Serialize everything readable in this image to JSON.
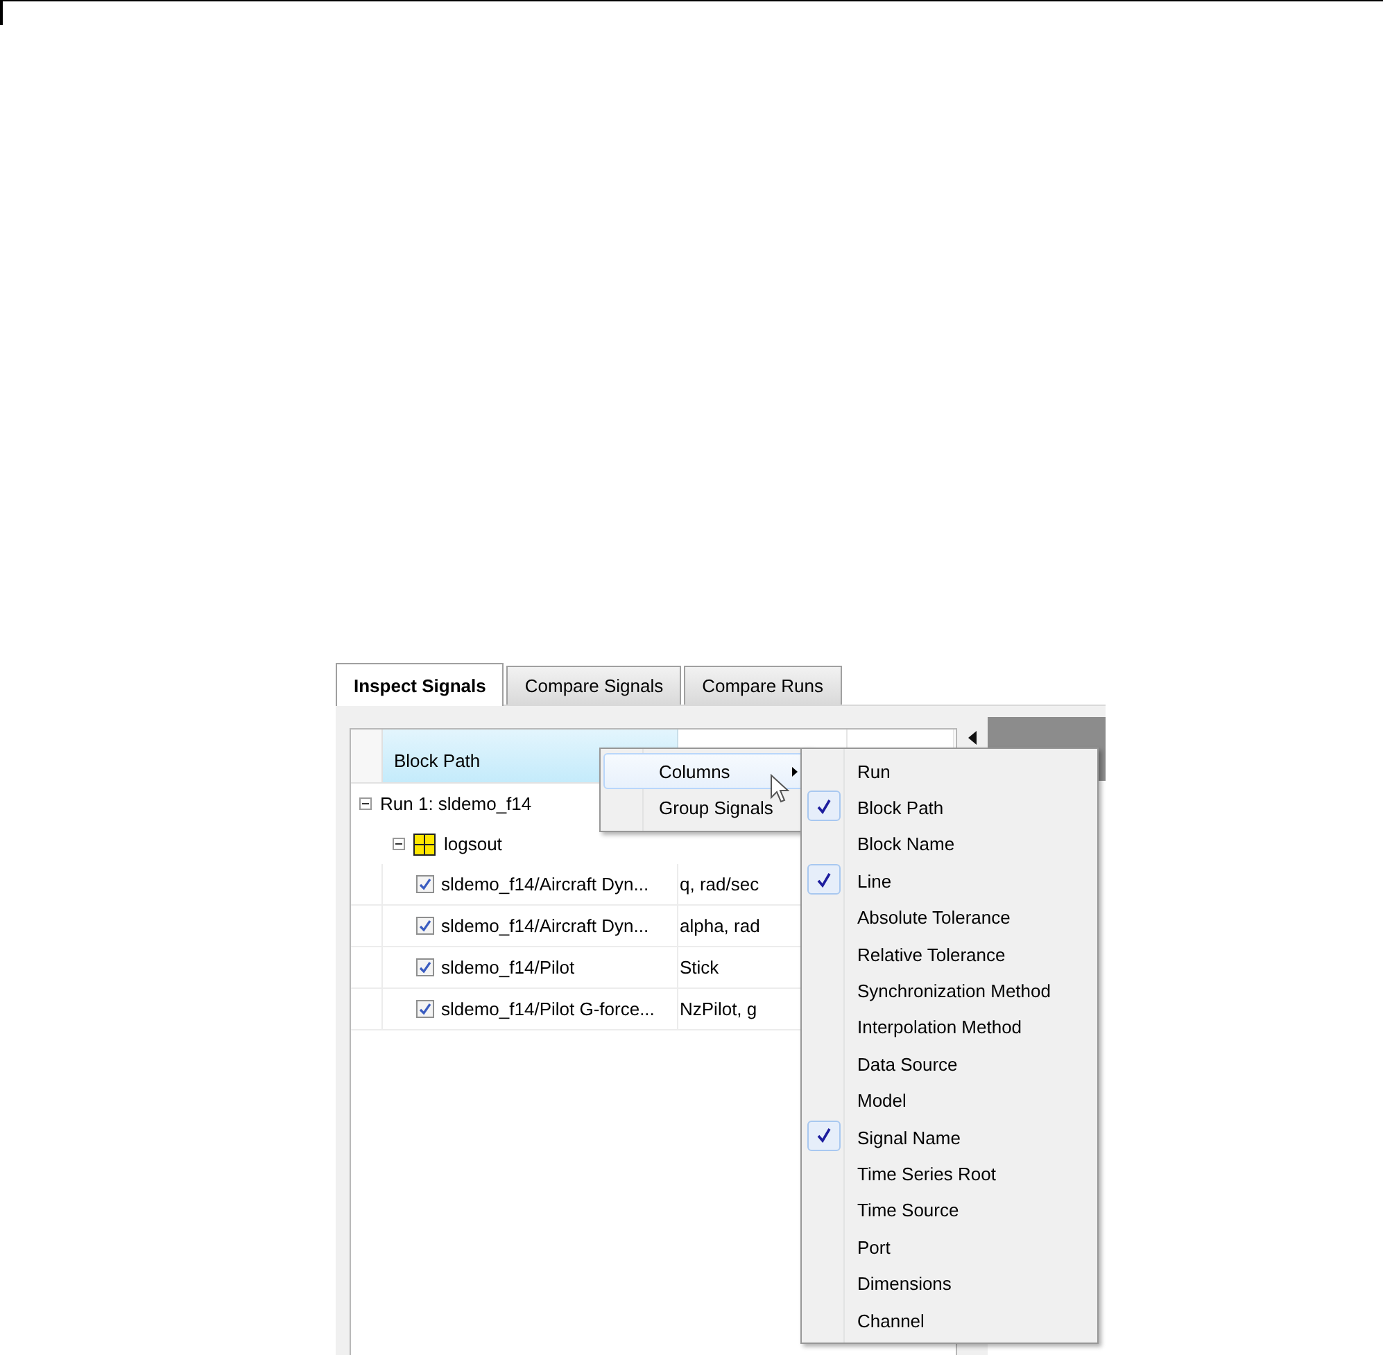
{
  "tabs": [
    {
      "label": "Inspect Signals",
      "selected": true
    },
    {
      "label": "Compare Signals",
      "selected": false
    },
    {
      "label": "Compare Runs",
      "selected": false
    }
  ],
  "table": {
    "header": "Block Path",
    "rows": [
      {
        "kind": "run",
        "label": "Run 1: sldemo_f14",
        "expanded": true,
        "children": [
          {
            "kind": "group",
            "label": "logsout",
            "expanded": true,
            "children": [
              {
                "kind": "signal",
                "label": "sldemo_f14/Aircraft Dyn...",
                "signal": "q, rad/sec",
                "checked": true
              },
              {
                "kind": "signal",
                "label": "sldemo_f14/Aircraft Dyn...",
                "signal": "alpha, rad",
                "checked": true
              },
              {
                "kind": "signal",
                "label": "sldemo_f14/Pilot",
                "signal": "Stick",
                "checked": true
              },
              {
                "kind": "signal",
                "label": "sldemo_f14/Pilot G-force...",
                "signal": "NzPilot, g",
                "checked": true
              }
            ]
          }
        ]
      }
    ]
  },
  "context_menu": {
    "items": [
      {
        "label": "Columns",
        "submenu": true,
        "selected": true
      },
      {
        "label": "Group Signals",
        "submenu": false,
        "selected": false
      }
    ]
  },
  "columns_menu": {
    "items": [
      {
        "label": "Run",
        "checked": false
      },
      {
        "label": "Block Path",
        "checked": true
      },
      {
        "label": "Block Name",
        "checked": false
      },
      {
        "label": "Line",
        "checked": true
      },
      {
        "label": "Absolute Tolerance",
        "checked": false
      },
      {
        "label": "Relative Tolerance",
        "checked": false
      },
      {
        "label": "Synchronization Method",
        "checked": false
      },
      {
        "label": "Interpolation Method",
        "checked": false
      },
      {
        "label": "Data Source",
        "checked": false
      },
      {
        "label": "Model",
        "checked": false
      },
      {
        "label": "Signal Name",
        "checked": true
      },
      {
        "label": "Time Series Root",
        "checked": false
      },
      {
        "label": "Time Source",
        "checked": false
      },
      {
        "label": "Port",
        "checked": false
      },
      {
        "label": "Dimensions",
        "checked": false
      },
      {
        "label": "Channel",
        "checked": false
      }
    ]
  }
}
